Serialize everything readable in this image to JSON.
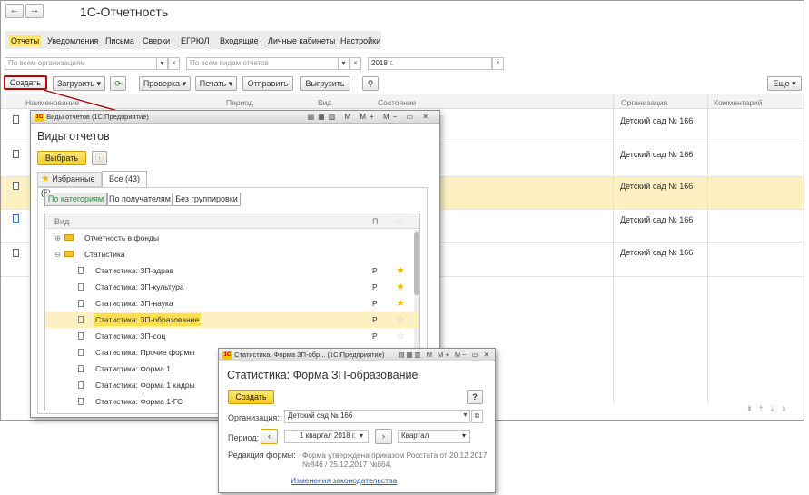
{
  "app": {
    "title": "1С-Отчетность"
  },
  "nav": {
    "back": "←",
    "forward": "→"
  },
  "tabs": [
    "Отчеты",
    "Уведомления",
    "Письма",
    "Сверки",
    "ЕГРЮЛ",
    "Входящие",
    "Личные кабинеты",
    "Настройки"
  ],
  "filters": {
    "org_placeholder": "По всем организациям",
    "type_placeholder": "По всем видам отчетов",
    "year": "2018 г."
  },
  "toolbar": {
    "create": "Создать",
    "load": "Загрузить",
    "check": "Проверка",
    "print": "Печать",
    "send": "Отправить",
    "unload": "Выгрузить",
    "more": "Еще"
  },
  "table": {
    "columns": [
      "Наименование",
      "Период",
      "Вид",
      "Состояние",
      "Организация",
      "Комментарий"
    ],
    "rows": [
      "Детский сад № 166",
      "Детский сад № 166",
      "Детский сад № 166",
      "Детский сад № 166",
      "Детский сад № 166"
    ]
  },
  "report_types": {
    "window_title": "Виды отчетов  (1С:Предприятие)",
    "heading": "Виды отчетов",
    "select": "Выбрать",
    "tab_fav": "Избранные (5)",
    "tab_all": "Все (43)",
    "grp_cat": "По категориям",
    "grp_rec": "По получателям",
    "grp_none": "Без группировки",
    "col_kind": "Вид",
    "col_p": "П",
    "items": [
      {
        "name": "Отчетность в фонды",
        "p": "",
        "star": ""
      },
      {
        "name": "Статистика",
        "p": "",
        "star": ""
      },
      {
        "name": "Статистика: ЗП-здрав",
        "p": "Р",
        "star": "full"
      },
      {
        "name": "Статистика: ЗП-культура",
        "p": "Р",
        "star": "full"
      },
      {
        "name": "Статистика: ЗП-наука",
        "p": "Р",
        "star": "full"
      },
      {
        "name": "Статистика: ЗП-образование",
        "p": "Р",
        "star": "empty"
      },
      {
        "name": "Статистика: ЗП-соц",
        "p": "Р",
        "star": "empty"
      },
      {
        "name": "Статистика: Прочие формы",
        "p": "",
        "star": ""
      },
      {
        "name": "Статистика: Форма 1",
        "p": "",
        "star": ""
      },
      {
        "name": "Статистика: Форма 1 кадры",
        "p": "",
        "star": ""
      },
      {
        "name": "Статистика: Форма 1-ГС",
        "p": "",
        "star": ""
      }
    ]
  },
  "form": {
    "window_title": "Статистика: Форма ЗП-обр...  (1С:Предприятие)",
    "heading": "Статистика: Форма ЗП-образование",
    "create": "Создать",
    "help": "?",
    "org_label": "Организация:",
    "org_value": "Детский сад № 166",
    "period_label": "Период:",
    "period_value": "1 квартал 2018 г.",
    "period_kind": "Квартал",
    "edition_label": "Редакция формы:",
    "edition_text1": "Форма утверждена приказом Росстата от 20.12.2017",
    "edition_text2": "№846 / 25.12.2017 №864.",
    "changes_link": "Изменения законодательства"
  },
  "colors": {
    "accent_yellow": "#f5cd1f",
    "highlight_red": "#c00000",
    "row_selected": "#fdf1c4"
  }
}
